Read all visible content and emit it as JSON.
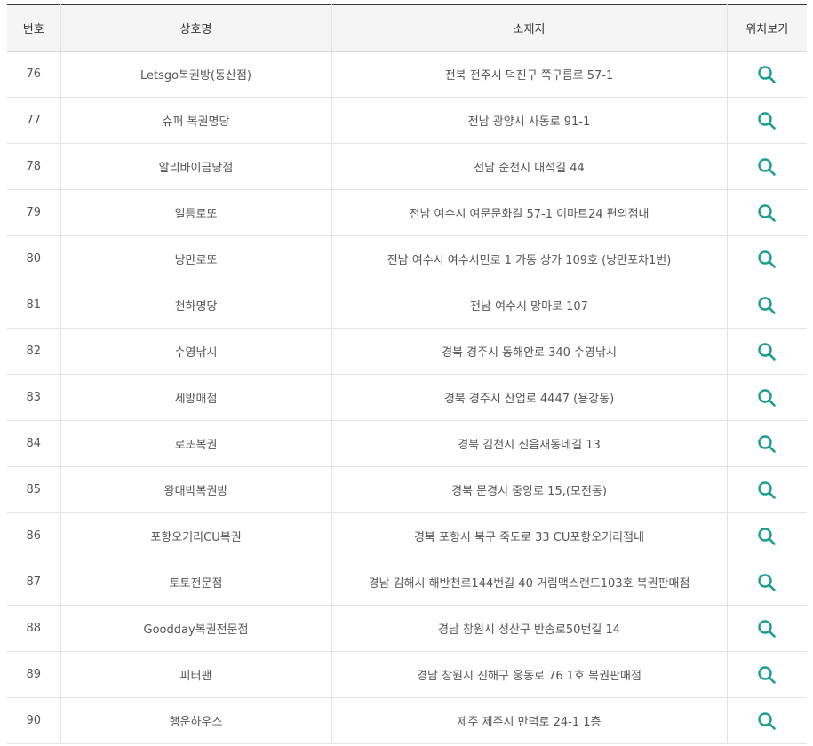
{
  "table": {
    "headers": {
      "no": "번호",
      "name": "상호명",
      "address": "소재지",
      "location": "위치보기"
    },
    "rows": [
      {
        "no": "76",
        "name": "Letsgo복권방(동산점)",
        "address": "전북 전주시 덕진구 쪽구름로 57-1"
      },
      {
        "no": "77",
        "name": "슈퍼 복권명당",
        "address": "전남 광양시 사동로 91-1"
      },
      {
        "no": "78",
        "name": "알리바이금당점",
        "address": "전남 순천시 대석길 44"
      },
      {
        "no": "79",
        "name": "일등로또",
        "address": "전남 여수시 여문문화길 57-1 이마트24 편의점내"
      },
      {
        "no": "80",
        "name": "낭만로또",
        "address": "전남 여수시 여수시민로 1 가동 상가 109호 (낭만포차1번)"
      },
      {
        "no": "81",
        "name": "천하명당",
        "address": "전남 여수시 망마로 107"
      },
      {
        "no": "82",
        "name": "수영낚시",
        "address": "경북 경주시 동해안로 340 수영낚시"
      },
      {
        "no": "83",
        "name": "세방매점",
        "address": "경북 경주시 산업로 4447 (용강동)"
      },
      {
        "no": "84",
        "name": "로또복권",
        "address": "경북 김천시 신음새동네길 13"
      },
      {
        "no": "85",
        "name": "왕대박복권방",
        "address": "경북 문경시 중앙로 15,(모전동)"
      },
      {
        "no": "86",
        "name": "포항오거리CU복권",
        "address": "경북 포항시 북구 죽도로 33 CU포항오거리점내"
      },
      {
        "no": "87",
        "name": "토토전문점",
        "address": "경남 김해시 해반천로144번길 40 거림맥스랜드103호 복권판매점"
      },
      {
        "no": "88",
        "name": "Goodday복권전문점",
        "address": "경남 창원시 성산구 반송로50번길 14"
      },
      {
        "no": "89",
        "name": "피터팬",
        "address": "경남 창원시 진해구 웅동로 76 1호 복권판매점"
      },
      {
        "no": "90",
        "name": "행운하우스",
        "address": "제주 제주시 만덕로 24-1 1층"
      }
    ]
  },
  "colors": {
    "accent": "#1a9e8e",
    "header_bg": "#f5f5f5"
  },
  "icons": {
    "location": "search-icon"
  }
}
